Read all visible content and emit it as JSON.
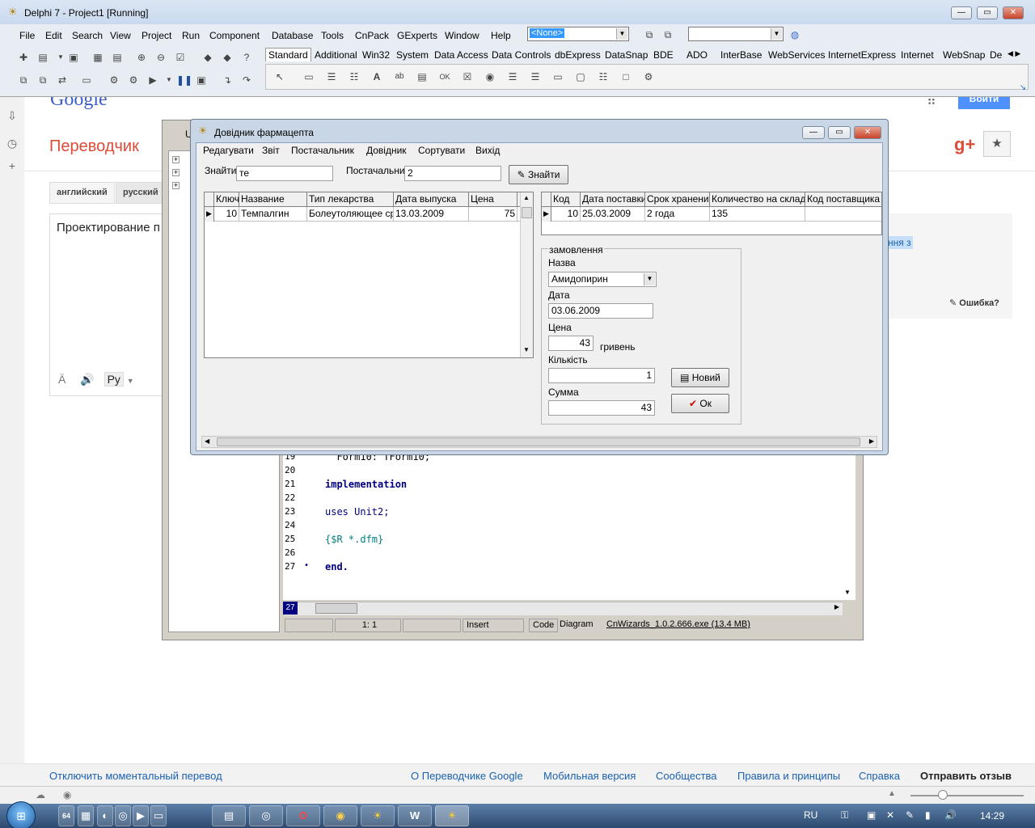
{
  "google": {
    "logo": "Google",
    "title": "Переводчик",
    "lang_tabs": [
      "английский",
      "русский"
    ],
    "source_text": "Проектирование п средствами объе использованием б",
    "source_tools": [
      "Ä",
      "🔊",
      "Ру"
    ],
    "highlight_text": "ння з",
    "error_link": "Ошибка?",
    "login": "Войти",
    "footer": [
      "Отключить моментальный перевод",
      "О Переводчике Google",
      "Мобильная версия",
      "Сообщества",
      "Правила и принципы",
      "Справка",
      "Отправить отзыв"
    ]
  },
  "ide": {
    "title": "Delphi 7 - Project1 [Running]",
    "menu": [
      "File",
      "Edit",
      "Search",
      "View",
      "Project",
      "Run",
      "Component",
      "Database",
      "Tools",
      "CnPack",
      "GExperts",
      "Window",
      "Help"
    ],
    "combo1": "<None>",
    "combo2": "",
    "palette_tabs": [
      "Standard",
      "Additional",
      "Win32",
      "System",
      "Data Access",
      "Data Controls",
      "dbExpress",
      "DataSnap",
      "BDE",
      "ADO",
      "InterBase",
      "WebServices",
      "InternetExpress",
      "Internet",
      "WebSnap",
      "De"
    ]
  },
  "editor": {
    "title_fragment": "U",
    "lines": [
      {
        "n": "19",
        "code": "  Form10: TForm10;"
      },
      {
        "n": "20",
        "code": ""
      },
      {
        "n": "21",
        "code": "implementation"
      },
      {
        "n": "22",
        "code": ""
      },
      {
        "n": "23",
        "code": "uses Unit2;"
      },
      {
        "n": "24",
        "code": ""
      },
      {
        "n": "25",
        "code": "{$R *.dfm}"
      },
      {
        "n": "26",
        "code": ""
      },
      {
        "n": "27",
        "code": "end."
      }
    ],
    "current_line": "27",
    "status": {
      "position": "1:  1",
      "mode": "Insert",
      "tab_code": "Code",
      "tab_diagram": "Diagram",
      "file": "CnWizards_1.0.2.666.exe (13.4 MB)"
    }
  },
  "pharm": {
    "title": "Довідник фармацепта",
    "menu": [
      "Редагувати",
      "Звіт",
      "Постачальник",
      "Довідник",
      "Сортувати",
      "Вихід"
    ],
    "find_label": "Знайти",
    "find_value": "те",
    "supplier_label": "Постачальник",
    "supplier_value": "2",
    "find_button": "Знайти",
    "grid1": {
      "columns": [
        "Ключ",
        "Название",
        "Тип лекарства",
        "Дата выпуска",
        "Цена"
      ],
      "row": [
        "10",
        "Темпалгин",
        "Болеутоляющее сре",
        "13.03.2009",
        "75"
      ]
    },
    "grid2": {
      "columns": [
        "Код",
        "Дата поставки",
        "Срок хранения",
        "Количество на складе",
        "Код поставщика"
      ],
      "row": [
        "10",
        "25.03.2009",
        "2 года",
        "135",
        ""
      ]
    },
    "order": {
      "group_label": "замовлення",
      "name_label": "Назва",
      "name_value": "Амидопирин",
      "date_label": "Дата",
      "date_value": "03.06.2009",
      "price_label": "Цена",
      "price_value": "43",
      "currency": "гривень",
      "qty_label": "Кількість",
      "qty_value": "1",
      "sum_label": "Сумма",
      "sum_value": "43",
      "new_button": "Новий",
      "ok_button": "Ок"
    }
  },
  "taskbar": {
    "lang": "RU",
    "time": "14:29"
  }
}
